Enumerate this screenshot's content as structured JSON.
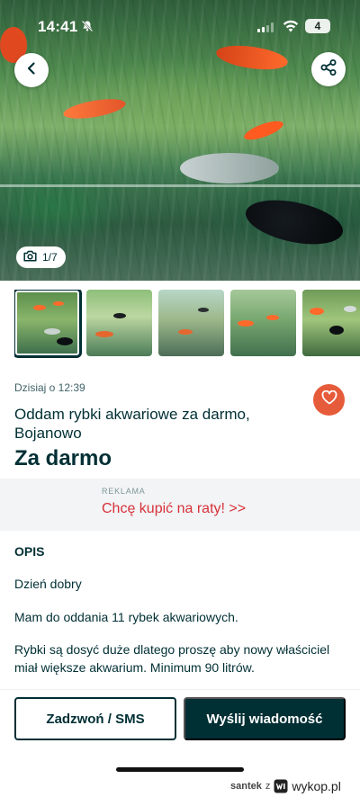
{
  "status_bar": {
    "time": "14:41",
    "battery": "4"
  },
  "gallery": {
    "counter": "1/7",
    "thumbnail_count": 5
  },
  "listing": {
    "posted": "Dzisiaj o 12:39",
    "title": "Oddam rybki akwariowe za darmo, Bojanowo",
    "price": "Za darmo"
  },
  "ad": {
    "label": "REKLAMA",
    "link_text": "Chcę kupić na raty! >>"
  },
  "description": {
    "heading": "OPIS",
    "paragraphs": [
      "Dzień dobry",
      "Mam do oddania 11 rybek akwariowych.",
      "Rybki są dosyć duże dlatego proszę aby nowy właściciel miał większe akwarium. Minimum 90 litrów."
    ]
  },
  "actions": {
    "call_label": "Zadzwoń / SMS",
    "message_label": "Wyślij wiadomość"
  },
  "watermark": {
    "user": "santek",
    "separator": "z",
    "site": "wykop.pl"
  },
  "colors": {
    "primary": "#002f34",
    "favorite": "#e65b3a",
    "ad_link": "#d8313a"
  }
}
